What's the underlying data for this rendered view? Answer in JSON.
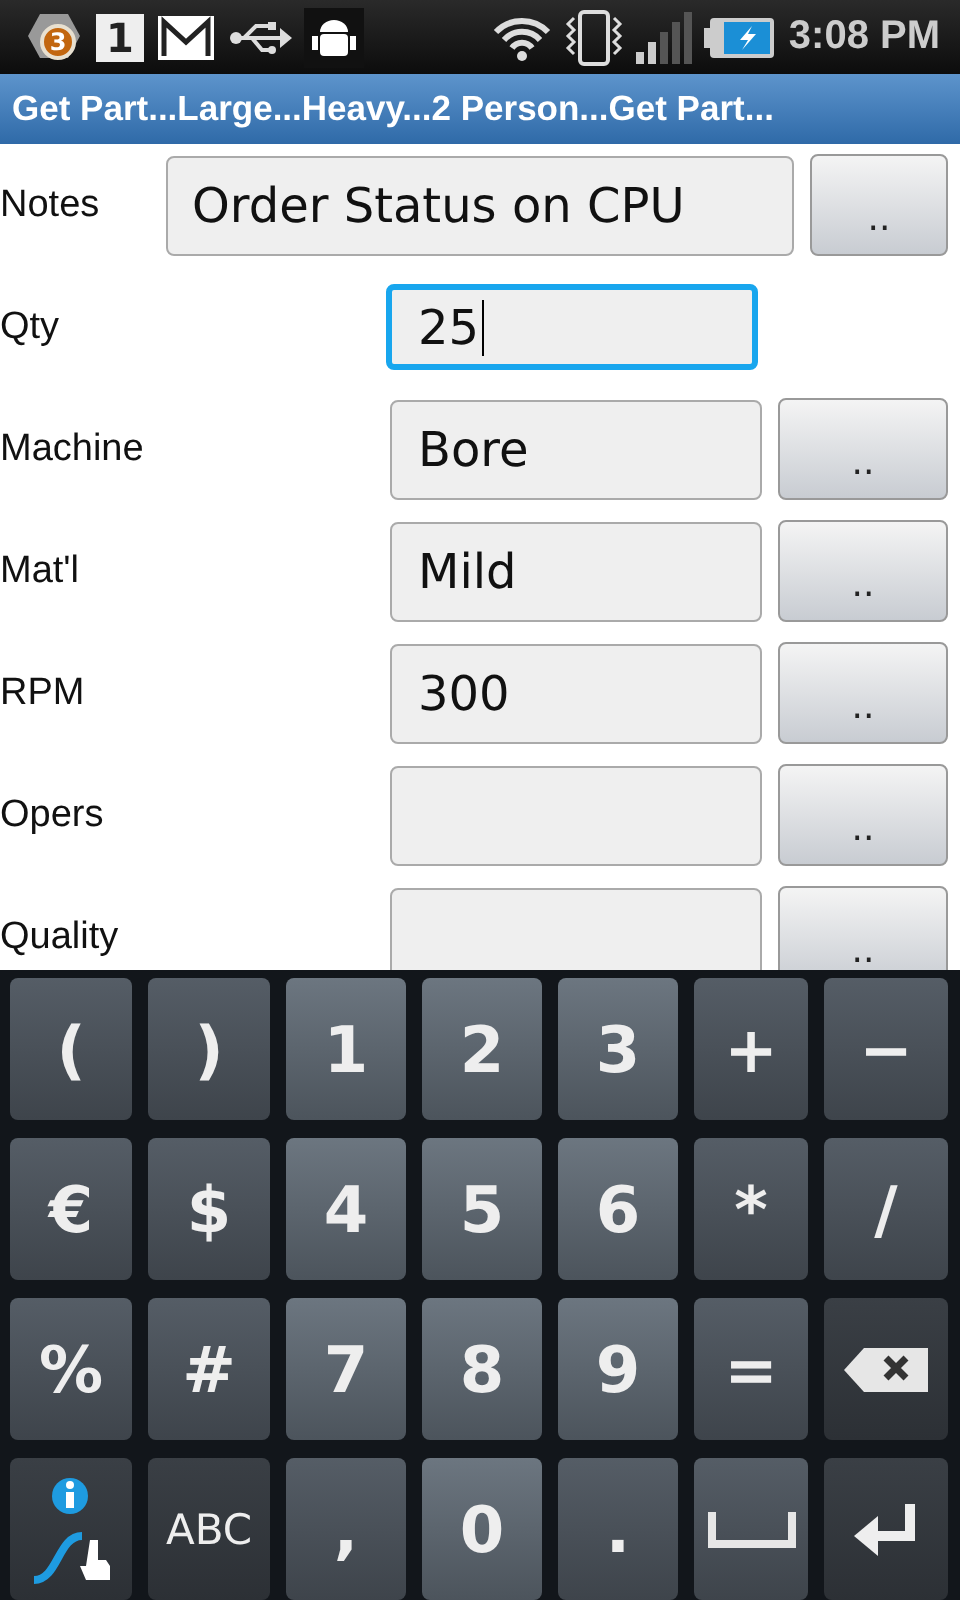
{
  "status_bar": {
    "notification_count": "3",
    "calendar_day": "1",
    "time": "3:08 PM"
  },
  "title_bar": {
    "title": "Get Part...Large...Heavy...2 Person...Get Part..."
  },
  "form": {
    "fields": [
      {
        "label": "Notes",
        "value": "Order Status on CPU",
        "focused": false,
        "wide": true,
        "button": ".."
      },
      {
        "label": "Qty",
        "value": "25",
        "focused": true,
        "wide": false
      },
      {
        "label": "Machine",
        "value": "Bore",
        "focused": false,
        "wide": false,
        "button": ".."
      },
      {
        "label": "Mat'l",
        "value": "Mild",
        "focused": false,
        "wide": false,
        "button": ".."
      },
      {
        "label": "RPM",
        "value": "300",
        "focused": false,
        "wide": false,
        "button": ".."
      },
      {
        "label": "Opers",
        "focused": false,
        "wide": false,
        "button": ".."
      },
      {
        "label": "Quality",
        "focused": false,
        "wide": false,
        "button": ".."
      }
    ]
  },
  "keyboard": {
    "keys": [
      {
        "kind": "symbol",
        "label": "("
      },
      {
        "kind": "symbol",
        "label": ")"
      },
      {
        "kind": "digit",
        "label": "1"
      },
      {
        "kind": "digit",
        "label": "2"
      },
      {
        "kind": "digit",
        "label": "3"
      },
      {
        "kind": "symbol",
        "label": "+"
      },
      {
        "kind": "symbol",
        "label": "−"
      },
      {
        "kind": "symbol",
        "label": "€"
      },
      {
        "kind": "symbol",
        "label": "$"
      },
      {
        "kind": "digit",
        "label": "4"
      },
      {
        "kind": "digit",
        "label": "5"
      },
      {
        "kind": "digit",
        "label": "6"
      },
      {
        "kind": "symbol",
        "label": "*"
      },
      {
        "kind": "symbol",
        "label": "/"
      },
      {
        "kind": "symbol",
        "label": "%"
      },
      {
        "kind": "symbol",
        "label": "#"
      },
      {
        "kind": "digit",
        "label": "7"
      },
      {
        "kind": "digit",
        "label": "8"
      },
      {
        "kind": "digit",
        "label": "9"
      },
      {
        "kind": "symbol",
        "label": "="
      },
      {
        "kind": "backspace"
      },
      {
        "kind": "swype"
      },
      {
        "kind": "mode",
        "label": "ABC"
      },
      {
        "kind": "symbol",
        "label": ","
      },
      {
        "kind": "digit",
        "label": "0"
      },
      {
        "kind": "symbol",
        "label": "."
      },
      {
        "kind": "space"
      },
      {
        "kind": "enter"
      }
    ]
  }
}
